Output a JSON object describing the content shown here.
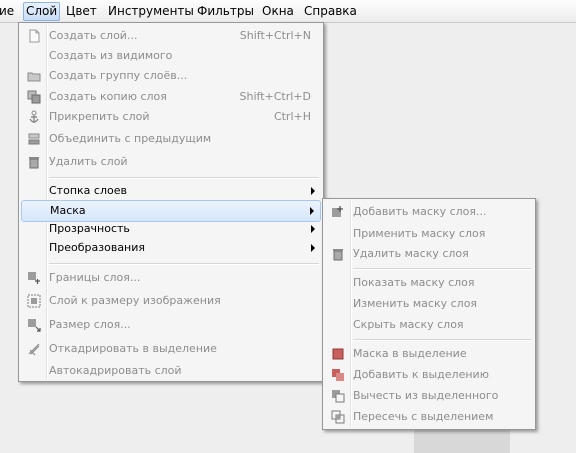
{
  "menubar": {
    "items": [
      {
        "label": "ие",
        "name": "menubar-item-image",
        "active": false
      },
      {
        "label": "Слой",
        "name": "menubar-item-layer",
        "active": true
      },
      {
        "label": "Цвет",
        "name": "menubar-item-colors",
        "active": false
      },
      {
        "label": "Инструменты",
        "name": "menubar-item-tools",
        "active": false
      },
      {
        "label": "Фильтры",
        "name": "menubar-item-filters",
        "active": false
      },
      {
        "label": "Окна",
        "name": "menubar-item-windows",
        "active": false
      },
      {
        "label": "Справка",
        "name": "menubar-item-help",
        "active": false
      }
    ]
  },
  "layer_menu": {
    "new_layer": {
      "label": "Создать слой...",
      "shortcut": "Shift+Ctrl+N",
      "icon": "new-layer-icon"
    },
    "new_from_visible": {
      "label": "Создать из видимого"
    },
    "new_layer_group": {
      "label": "Создать группу слоёв...",
      "icon": "folder-icon"
    },
    "duplicate_layer": {
      "label": "Создать копию слоя",
      "shortcut": "Shift+Ctrl+D",
      "icon": "duplicate-icon"
    },
    "anchor_layer": {
      "label": "Прикрепить слой",
      "shortcut": "Ctrl+H",
      "icon": "anchor-icon"
    },
    "merge_down": {
      "label": "Объединить с предыдущим",
      "icon": "merge-down-icon"
    },
    "delete_layer": {
      "label": "Удалить слой",
      "icon": "trash-icon"
    },
    "stack": {
      "label": "Стопка слоев"
    },
    "mask": {
      "label": "Маска"
    },
    "transparency": {
      "label": "Прозрачность"
    },
    "transform": {
      "label": "Преобразования"
    },
    "boundary_size": {
      "label": "Границы слоя...",
      "icon": "boundary-icon"
    },
    "layer_to_image_size": {
      "label": "Слой к размеру изображения",
      "icon": "fit-image-icon"
    },
    "scale_layer": {
      "label": "Размер слоя...",
      "icon": "scale-icon"
    },
    "crop_to_selection": {
      "label": "Откадрировать в выделение",
      "icon": "crop-icon"
    },
    "autocrop_layer": {
      "label": "Автокадрировать слой"
    }
  },
  "mask_menu": {
    "add_mask": {
      "label": "Добавить маску слоя...",
      "icon": "add-mask-icon"
    },
    "apply_mask": {
      "label": "Применить маску слоя"
    },
    "delete_mask": {
      "label": "Удалить маску слоя",
      "icon": "trash-icon"
    },
    "show_mask": {
      "label": "Показать маску слоя"
    },
    "edit_mask": {
      "label": "Изменить маску слоя"
    },
    "disable_mask": {
      "label": "Скрыть маску слоя"
    },
    "mask_to_selection": {
      "label": "Маска в выделение",
      "icon": "mask-to-selection-icon"
    },
    "add_to_selection": {
      "label": "Добавить к выделению",
      "icon": "selection-add-icon"
    },
    "subtract_from_selection": {
      "label": "Вычесть из выделенного",
      "icon": "selection-subtract-icon"
    },
    "intersect_with_selection": {
      "label": "Пересечь с выделением",
      "icon": "selection-intersect-icon"
    }
  },
  "colors": {
    "disabled_text": "#8d8d8d",
    "selection_bg": "#d7e7fa",
    "selection_border": "#a8c8ee",
    "mask_icon_red": "#c0504d"
  }
}
